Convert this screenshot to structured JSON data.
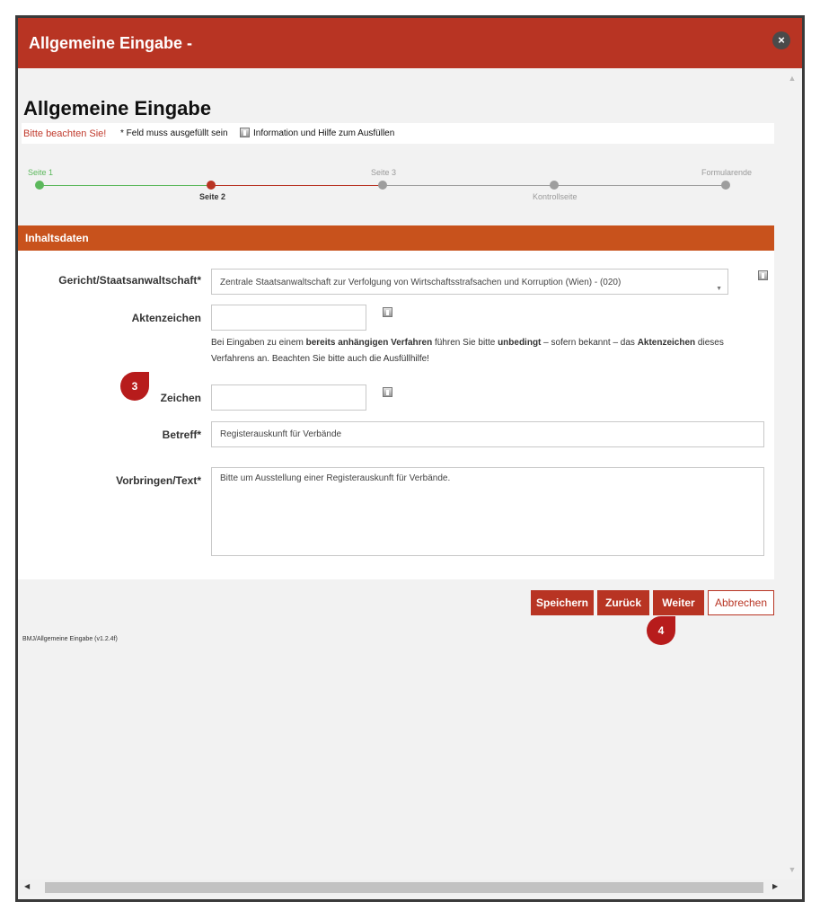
{
  "window": {
    "title": "Allgemeine Eingabe -",
    "close_icon": "×"
  },
  "page": {
    "heading": "Allgemeine Eingabe",
    "notice_warning": "Bitte beachten Sie!",
    "notice_required": "* Feld muss ausgefüllt sein",
    "notice_help": "Information und Hilfe zum Ausfüllen"
  },
  "steps": [
    {
      "label": "Seite 1",
      "state": "done",
      "color": "#5cb85c"
    },
    {
      "label": "Seite 2",
      "state": "current",
      "color": "#b83423"
    },
    {
      "label": "Seite 3",
      "state": "todo",
      "color": "#9e9e9e"
    },
    {
      "label": "Kontrollseite",
      "state": "todo",
      "color": "#9e9e9e"
    },
    {
      "label": "Formularende",
      "state": "todo",
      "color": "#9e9e9e"
    }
  ],
  "section": {
    "title": "Inhaltsdaten"
  },
  "form": {
    "gericht_label": "Gericht/Staatsanwaltschaft*",
    "gericht_value": "Zentrale Staatsanwaltschaft zur Verfolgung von Wirtschaftsstrafsachen und Korruption (Wien) - (020)",
    "aktenzeichen_label": "Aktenzeichen",
    "aktenzeichen_value": "",
    "hint_1": "Bei Eingaben zu einem ",
    "hint_b1": "bereits anhängigen Verfahren",
    "hint_2": " führen Sie bitte ",
    "hint_b2": "unbedingt",
    "hint_3": " – sofern bekannt – das ",
    "hint_b3": "Aktenzeichen",
    "hint_4": " dieses Verfahrens an. Beachten Sie bitte auch die Ausfüllhilfe!",
    "zeichen_label": "Zeichen",
    "zeichen_value": "",
    "betreff_label": "Betreff*",
    "betreff_value": "Registerauskunft für Verbände",
    "vorbringen_label": "Vorbringen/Text*",
    "vorbringen_value": "Bitte um Ausstellung einer Registerauskunft für Verbände."
  },
  "badges": {
    "step3": "3",
    "step4": "4"
  },
  "buttons": {
    "save": "Speichern",
    "back": "Zurück",
    "next": "Weiter",
    "cancel": "Abbrechen"
  },
  "footer": {
    "version": "BMJ/Allgemeine Eingabe (v1.2.4f)"
  },
  "colors": {
    "titlebar": "#b83423",
    "section": "#c8521c",
    "badge": "#b71c1c"
  }
}
